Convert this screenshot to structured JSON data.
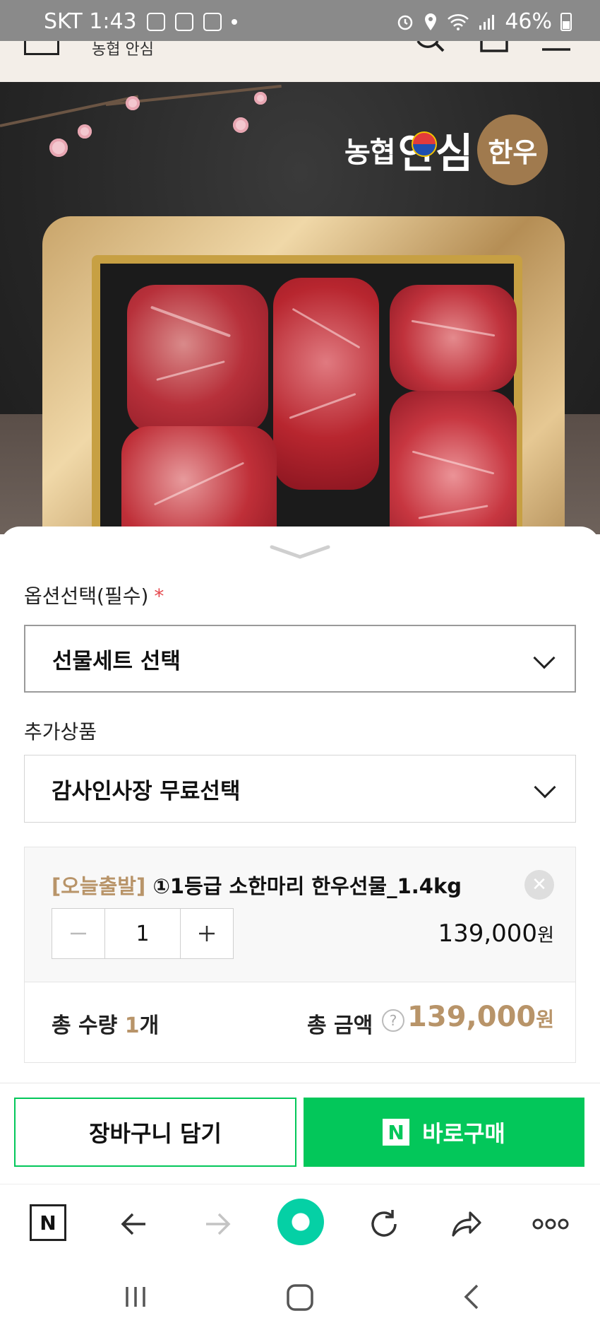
{
  "status_bar": {
    "carrier_time": "SKT 1:43",
    "battery": "46%"
  },
  "hero": {
    "brand_small": "농협",
    "brand_big": "안심",
    "brand_badge": "한우"
  },
  "option": {
    "label": "옵션선택(필수)",
    "required_mark": "*",
    "select_value": "선물세트 선택"
  },
  "addon": {
    "label": "추가상품",
    "select_value": "감사인사장 무료선택"
  },
  "selected_item": {
    "tag": "[오늘출발]",
    "name": "①1등급 소한마리 한우선물_1.4kg",
    "quantity": "1",
    "price": "139,000",
    "currency": "원"
  },
  "summary": {
    "qty_label": "총 수량",
    "qty_value": "1",
    "qty_unit": "개",
    "amount_label": "총 금액",
    "amount_value": "139,000",
    "currency": "원"
  },
  "actions": {
    "cart_label": "장바구니 담기",
    "buy_icon": "N",
    "buy_label": "바로구매"
  },
  "toolbar": {
    "home_icon": "N"
  },
  "colors": {
    "naver_green": "#03c75a",
    "gold_accent": "#b89469",
    "required_red": "#e5484d"
  },
  "icons": [
    "naver-home-icon",
    "back-arrow-icon",
    "forward-arrow-icon",
    "green-dot-icon",
    "refresh-icon",
    "share-icon",
    "more-icon"
  ]
}
